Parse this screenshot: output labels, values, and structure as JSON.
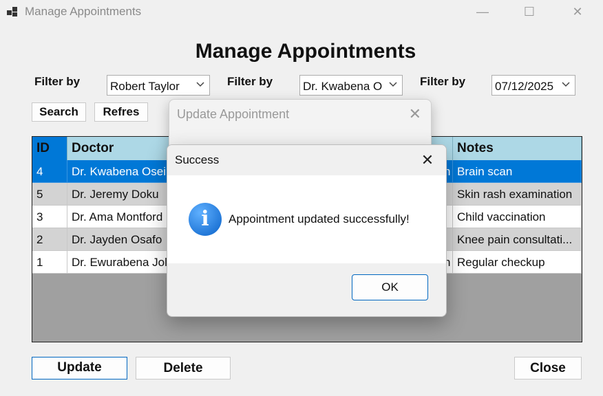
{
  "window": {
    "title": "Manage Appointments",
    "minimize": "—",
    "maximize": "☐",
    "close": "✕"
  },
  "heading": "Manage Appointments",
  "filters": [
    {
      "label": "Filter by",
      "value": "Robert Taylor"
    },
    {
      "label": "Filter by",
      "value": "Dr. Kwabena O"
    },
    {
      "label": "Filter by",
      "value": "07/12/2025"
    }
  ],
  "buttons": {
    "search": "Search",
    "refresh": "Refres",
    "update": "Update",
    "delete": "Delete",
    "close": "Close"
  },
  "grid": {
    "columns": [
      "ID",
      "Doctor",
      "Notes"
    ],
    "rows": [
      {
        "id": "4",
        "doctor": "Dr. Kwabena Osei",
        "mid": "n",
        "notes": "Brain scan",
        "selected": true
      },
      {
        "id": "5",
        "doctor": "Dr. Jeremy Doku",
        "mid": "",
        "notes": "Skin rash examination",
        "selected": false
      },
      {
        "id": "3",
        "doctor": "Dr. Ama Montford",
        "mid": "",
        "notes": "Child vaccination",
        "selected": false
      },
      {
        "id": "2",
        "doctor": "Dr. Jayden Osafo",
        "mid": "",
        "notes": "Knee pain consultati...",
        "selected": false
      },
      {
        "id": "1",
        "doctor": "Dr. Ewurabena Jol",
        "mid": "n",
        "notes": "Regular checkup",
        "selected": false
      }
    ]
  },
  "update_dialog": {
    "title": "Update Appointment",
    "close": "✕"
  },
  "message_box": {
    "title": "Success",
    "close": "✕",
    "icon": "i",
    "message": "Appointment updated successfully!",
    "ok": "OK"
  },
  "colors": {
    "header_bg": "#add8e6",
    "selected_bg": "#0078d7",
    "alt_row_bg": "#d3d3d3",
    "grid_bg": "#a0a0a0"
  }
}
